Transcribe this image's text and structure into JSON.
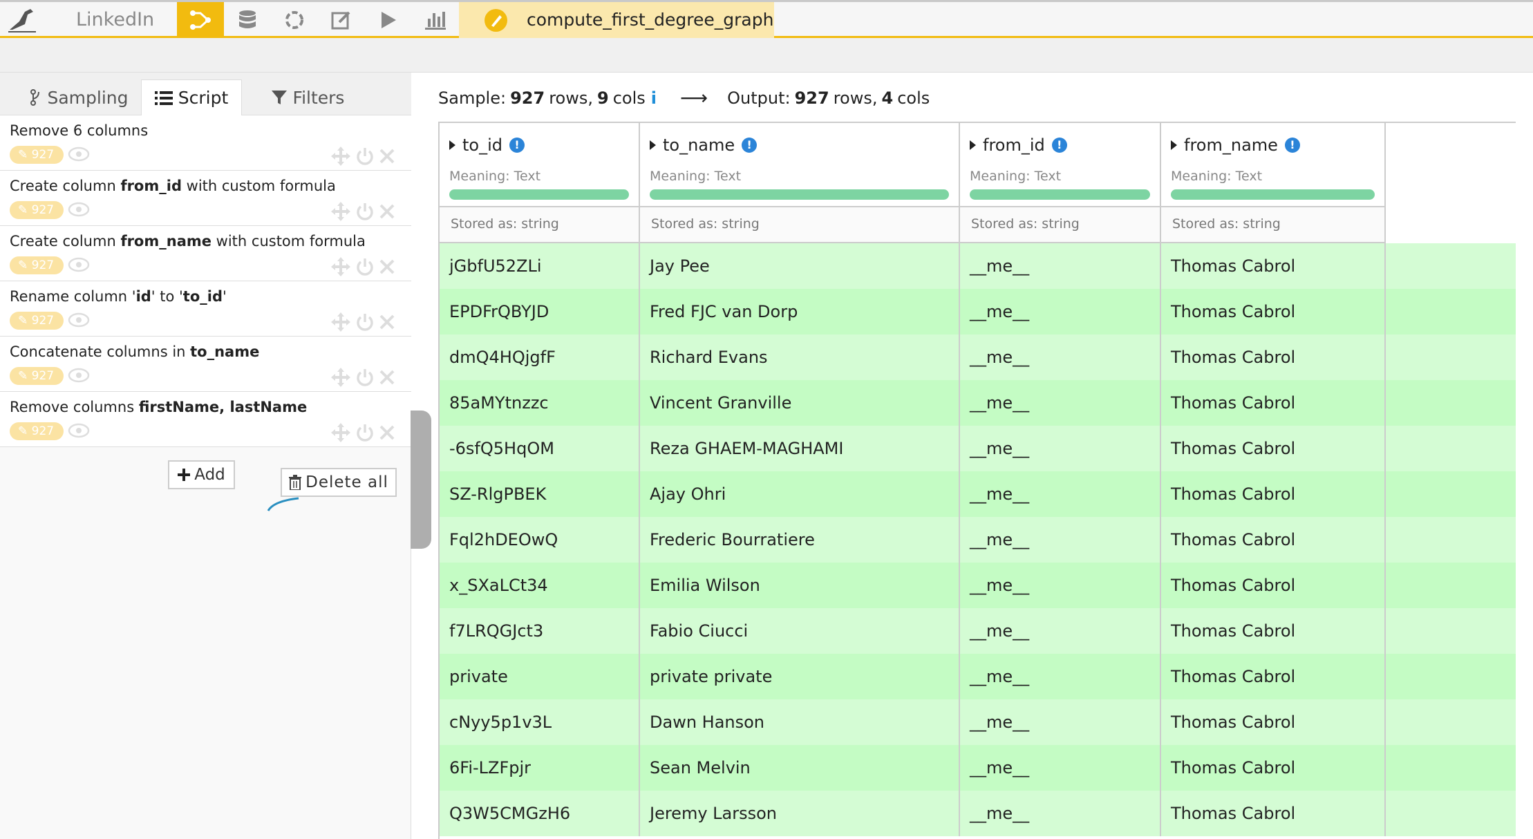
{
  "topbar": {
    "project_name": "LinkedIn",
    "recipe_name": "compute_first_degree_graph",
    "nav_icons": [
      "flow-icon",
      "datasets-icon",
      "recipes-icon",
      "notebooks-icon",
      "run-icon",
      "charts-icon"
    ],
    "accent_color": "#f2bb0f"
  },
  "left_panel": {
    "tabs": [
      {
        "label": "Sampling",
        "icon": "branch-icon"
      },
      {
        "label": "Script",
        "icon": "list-icon"
      },
      {
        "label": "Filters",
        "icon": "funnel-icon"
      }
    ],
    "steps": [
      {
        "parts": [
          {
            "t": "Remove 6 columns",
            "b": false
          }
        ],
        "count": "927"
      },
      {
        "parts": [
          {
            "t": "Create column ",
            "b": false
          },
          {
            "t": "from_id",
            "b": true
          },
          {
            "t": " with custom formula",
            "b": false
          }
        ],
        "count": "927"
      },
      {
        "parts": [
          {
            "t": "Create column ",
            "b": false
          },
          {
            "t": "from_name",
            "b": true
          },
          {
            "t": " with custom formula",
            "b": false
          }
        ],
        "count": "927"
      },
      {
        "parts": [
          {
            "t": "Rename column '",
            "b": false
          },
          {
            "t": "id",
            "b": true
          },
          {
            "t": "' to '",
            "b": false
          },
          {
            "t": "to_id",
            "b": true
          },
          {
            "t": "'",
            "b": false
          }
        ],
        "count": "927"
      },
      {
        "parts": [
          {
            "t": "Concatenate columns in ",
            "b": false
          },
          {
            "t": "to_name",
            "b": true
          }
        ],
        "count": "927"
      },
      {
        "parts": [
          {
            "t": "Remove columns ",
            "b": false
          },
          {
            "t": "firstName, lastName",
            "b": true
          }
        ],
        "count": "927"
      }
    ],
    "add_label": "Add",
    "delete_all_label": "Delete all"
  },
  "summary": {
    "sample_label": "Sample:",
    "sample_rows": "927",
    "rows_word": "rows,",
    "sample_cols": "9",
    "cols_word": "cols",
    "info": "i",
    "arrow": "⟶",
    "output_label": "Output:",
    "output_rows": "927",
    "output_cols": "4"
  },
  "grid": {
    "columns": [
      {
        "name": "to_id",
        "meaning": "Meaning: Text",
        "stored": "Stored as: string"
      },
      {
        "name": "to_name",
        "meaning": "Meaning: Text",
        "stored": "Stored as: string"
      },
      {
        "name": "from_id",
        "meaning": "Meaning: Text",
        "stored": "Stored as: string"
      },
      {
        "name": "from_name",
        "meaning": "Meaning: Text",
        "stored": "Stored as: string"
      }
    ],
    "rows": [
      [
        "jGbfU52ZLi",
        "Jay Pee",
        "__me__",
        "Thomas Cabrol"
      ],
      [
        "EPDFrQBYJD",
        "Fred FJC van Dorp",
        "__me__",
        "Thomas Cabrol"
      ],
      [
        "dmQ4HQjgfF",
        "Richard Evans",
        "__me__",
        "Thomas Cabrol"
      ],
      [
        "85aMYtnzzc",
        "Vincent Granville",
        "__me__",
        "Thomas Cabrol"
      ],
      [
        "-6sfQ5HqOM",
        "Reza GHAEM-MAGHAMI",
        "__me__",
        "Thomas Cabrol"
      ],
      [
        "SZ-RlgPBEK",
        "Ajay Ohri",
        "__me__",
        "Thomas Cabrol"
      ],
      [
        "Fql2hDEOwQ",
        "Frederic Bourratiere",
        "__me__",
        "Thomas Cabrol"
      ],
      [
        "x_SXaLCt34",
        "Emilia Wilson",
        "__me__",
        "Thomas Cabrol"
      ],
      [
        "f7LRQGJct3",
        "Fabio Ciucci",
        "__me__",
        "Thomas Cabrol"
      ],
      [
        "private",
        "private private",
        "__me__",
        "Thomas Cabrol"
      ],
      [
        "cNyy5p1v3L",
        "Dawn Hanson",
        "__me__",
        "Thomas Cabrol"
      ],
      [
        "6Fi-LZFpjr",
        "Sean Melvin",
        "__me__",
        "Thomas Cabrol"
      ],
      [
        "Q3W5CMGzH6",
        "Jeremy Larsson",
        "__me__",
        "Thomas Cabrol"
      ]
    ]
  }
}
